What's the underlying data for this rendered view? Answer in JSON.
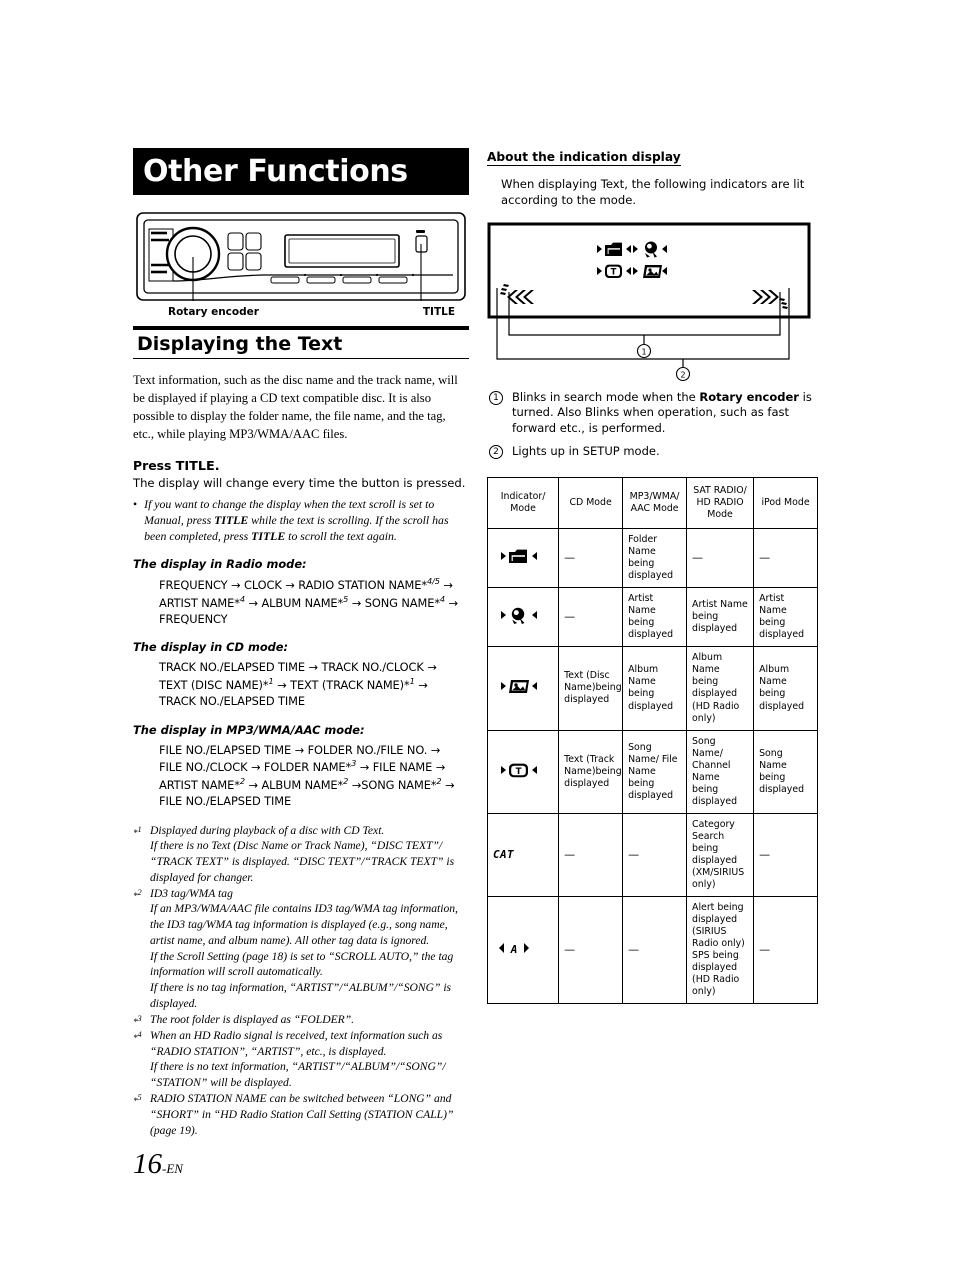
{
  "chapter": {
    "title": "Other Functions"
  },
  "unit_illustration": {
    "callout_left": "Rotary encoder",
    "callout_right": "TITLE"
  },
  "section": {
    "heading": "Displaying the Text",
    "intro": "Text information, such as the disc name and the track name, will be displayed if playing a CD text compatible disc. It is also possible to display the folder name, the file name, and the tag, etc., while playing MP3/WMA/AAC files.",
    "press_prefix": "Press ",
    "press_key": "TITLE.",
    "press_sub": "The display will change every time the button is pressed.",
    "bullet": {
      "part1": "If you want to change the display when the text scroll is set to Manual, press ",
      "key1": "TITLE",
      "part2": " while the text is scrolling. If the scroll has been completed, press ",
      "key2": "TITLE",
      "part3": " to scroll the text again."
    }
  },
  "flows": [
    {
      "heading": "The display in Radio mode:",
      "lines": [
        "FREQUENCY → CLOCK → RADIO STATION NAME*4/5 →",
        "ARTIST NAME*4 → ALBUM NAME*5 → SONG NAME*4 →",
        "FREQUENCY"
      ]
    },
    {
      "heading": "The display in CD mode:",
      "lines": [
        "TRACK NO./ELAPSED TIME → TRACK NO./CLOCK →",
        "TEXT (DISC NAME)*1 → TEXT (TRACK NAME)*1 →",
        "TRACK NO./ELAPSED TIME"
      ]
    },
    {
      "heading": "The display in MP3/WMA/AAC mode:",
      "lines": [
        "FILE NO./ELAPSED TIME → FOLDER NO./FILE NO. →",
        "FILE NO./CLOCK → FOLDER NAME*3 → FILE NAME →",
        "ARTIST NAME*2 → ALBUM NAME*2 →SONG NAME*2 →",
        "FILE NO./ELAPSED TIME"
      ]
    }
  ],
  "footnotes": [
    {
      "mark": "*1",
      "lines": [
        "Displayed during playback of a disc with CD Text.",
        "If there is no Text (Disc Name or Track Name), “DISC TEXT”/ “TRACK TEXT” is displayed. “DISC TEXT”/“TRACK TEXT” is displayed for changer."
      ]
    },
    {
      "mark": "*2",
      "lines": [
        "ID3 tag/WMA tag",
        "If an MP3/WMA/AAC file contains ID3 tag/WMA tag information, the ID3 tag/WMA tag information is displayed (e.g., song name, artist name, and album name). All other tag data is ignored.",
        "If the Scroll Setting (page 18) is set to “SCROLL AUTO,” the tag information will scroll automatically.",
        "If there is no tag information, “ARTIST”/“ALBUM”/“SONG” is displayed."
      ]
    },
    {
      "mark": "*3",
      "lines": [
        "The root folder is displayed as “FOLDER”."
      ]
    },
    {
      "mark": "*4",
      "lines": [
        "When an HD Radio signal is received, text information such as “RADIO STATION”, “ARTIST”, etc., is displayed.",
        "If there is no text information, “ARTIST”/“ALBUM”/“SONG”/ “STATION” will be displayed."
      ]
    },
    {
      "mark": "*5",
      "lines": [
        "RADIO STATION NAME can be switched between “LONG” and “SHORT” in “HD Radio Station Call Setting (STATION CALL)” (page 19)."
      ]
    }
  ],
  "right": {
    "sub_heading": "About the indication display",
    "intro": "When displaying Text, the following indicators are lit according to the mode.",
    "callouts": {
      "one": "1",
      "two": "2"
    },
    "notes": [
      {
        "num": "1",
        "part1": "Blinks in search mode when the ",
        "bold": "Rotary encoder",
        "part2": " is turned. Also Blinks when operation, such as fast forward etc., is performed."
      },
      {
        "num": "2",
        "part1": "Lights up in SETUP mode.",
        "bold": "",
        "part2": ""
      }
    ]
  },
  "table": {
    "headers": [
      "Indicator/ Mode",
      "CD Mode",
      "MP3/WMA/ AAC Mode",
      "SAT RADIO/ HD RADIO Mode",
      "iPod Mode"
    ],
    "dash": "—",
    "rows": [
      {
        "indicator": "folder-indicator",
        "indicator_text": "",
        "cd": "—",
        "mp3": "Folder Name being displayed",
        "sat": "—",
        "ipod": "—"
      },
      {
        "indicator": "artist-indicator",
        "indicator_text": "",
        "cd": "—",
        "mp3": "Artist Name being displayed",
        "sat": "Artist Name being displayed",
        "ipod": "Artist Name being displayed"
      },
      {
        "indicator": "album-indicator",
        "indicator_text": "",
        "cd": "Text (Disc Name)being displayed",
        "mp3": "Album Name being displayed",
        "sat": "Album Name being displayed (HD Radio only)",
        "ipod": "Album Name being displayed"
      },
      {
        "indicator": "track-indicator",
        "indicator_text": "",
        "cd": "Text (Track Name)being displayed",
        "mp3": "Song Name/ File Name being displayed",
        "sat": "Song Name/ Channel Name being displayed",
        "ipod": "Song Name being displayed"
      },
      {
        "indicator": "cat-indicator",
        "indicator_text": "CAT",
        "cd": "—",
        "mp3": "—",
        "sat": "Category Search being displayed (XM/SIRIUS only)",
        "ipod": "—"
      },
      {
        "indicator": "alert-indicator",
        "indicator_text": "A",
        "cd": "—",
        "mp3": "—",
        "sat": "Alert being displayed (SIRIUS Radio only) SPS being displayed (HD Radio only)",
        "ipod": "—"
      }
    ]
  },
  "page_number": {
    "num": "16",
    "suffix": "-EN"
  }
}
